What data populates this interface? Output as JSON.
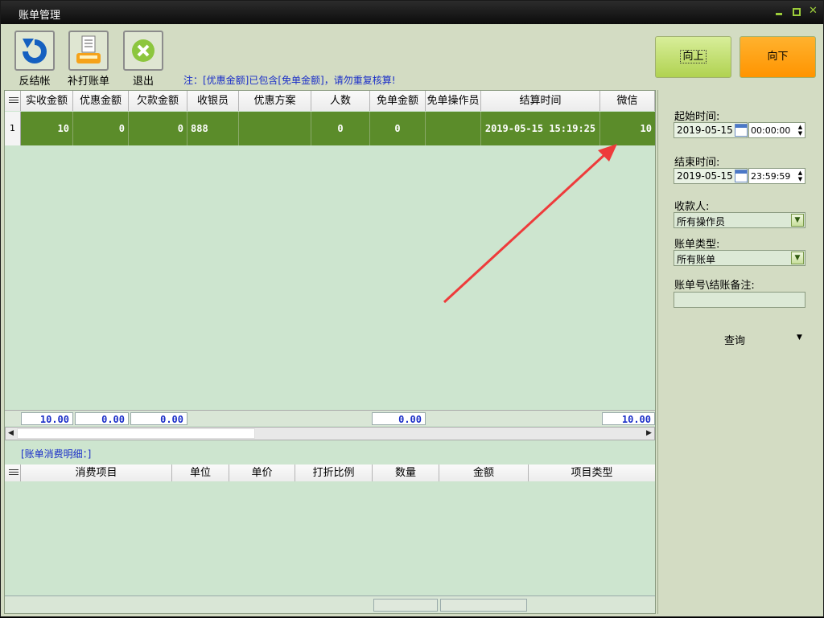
{
  "window": {
    "title": "账单管理"
  },
  "toolbar": {
    "buttons": [
      {
        "label": "反结帐",
        "icon": "undo-icon"
      },
      {
        "label": "补打账单",
        "icon": "printer-icon"
      },
      {
        "label": "退出",
        "icon": "close-circle-icon"
      }
    ],
    "note": "注：[优惠金额]已包含[免单金额]，请勿重复核算!",
    "nav_up": "向上",
    "nav_down": "向下"
  },
  "bill_grid": {
    "columns": [
      "实收金额",
      "优惠金额",
      "欠款金额",
      "收银员",
      "优惠方案",
      "人数",
      "免单金额",
      "免单操作员",
      "结算时间",
      "微信"
    ],
    "rows": [
      {
        "rownum": "1",
        "cells": [
          "10",
          "0",
          "0",
          "888",
          "",
          "0",
          "0",
          "",
          "2019-05-15 15:19:25",
          "10"
        ]
      }
    ],
    "totals": {
      "actual": "10.00",
      "discount": "0.00",
      "debt": "0.00",
      "free": "0.00",
      "wechat": "10.00"
    }
  },
  "detail": {
    "title": "[账单消费明细：]",
    "columns": [
      "消费项目",
      "单位",
      "单价",
      "打折比例",
      "数量",
      "金额",
      "项目类型"
    ]
  },
  "filters": {
    "start_label": "起始时间:",
    "start_date": "2019-05-15",
    "start_time": "00:00:00",
    "end_label": "结束时间:",
    "end_date": "2019-05-15",
    "end_time": "23:59:59",
    "payee_label": "收款人:",
    "payee_value": "所有操作员",
    "type_label": "账单类型:",
    "type_value": "所有账单",
    "remark_label": "账单号\\结账备注:",
    "remark_value": "",
    "query_label": "查询"
  },
  "colors": {
    "selected_row": "#5b8c2a",
    "nav_up": "#c8e07a",
    "nav_down": "#ff9c10",
    "note_text": "#1a2ec8",
    "annotation_arrow": "#ee3b3b"
  }
}
